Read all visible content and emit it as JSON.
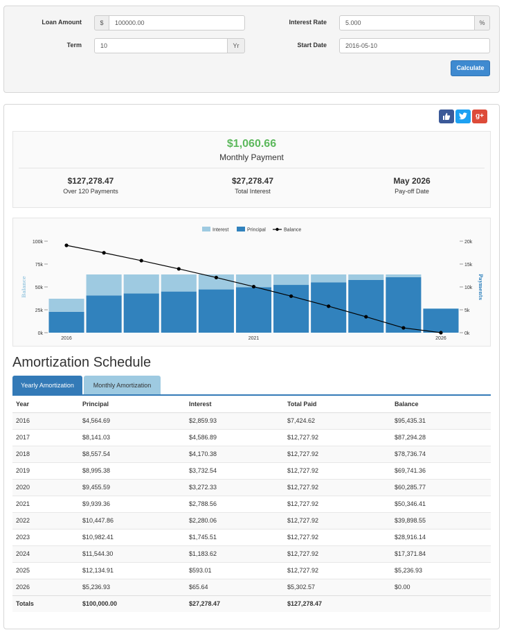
{
  "form": {
    "loan_amount_label": "Loan Amount",
    "currency_addon": "$",
    "loan_amount_value": "100000.00",
    "interest_rate_label": "Interest Rate",
    "interest_rate_value": "5.000",
    "percent_addon": "%",
    "term_label": "Term",
    "term_value": "10",
    "term_addon": "Yr",
    "start_date_label": "Start Date",
    "start_date_value": "2016-05-10",
    "calculate_label": "Calculate"
  },
  "share": {
    "like_icon": "thumbs-up-icon",
    "twitter_icon": "twitter-icon",
    "gplus_label": "g+",
    "colors": {
      "like": "#3b5998",
      "twitter": "#1da1f2",
      "gplus": "#dd4b39"
    }
  },
  "summary": {
    "monthly_payment": "$1,060.66",
    "monthly_payment_label": "Monthly Payment",
    "total_paid": "$127,278.47",
    "total_paid_label": "Over 120 Payments",
    "total_interest": "$27,278.47",
    "total_interest_label": "Total Interest",
    "payoff_date": "May 2026",
    "payoff_label": "Pay-off Date",
    "accent_color": "#5cb85c"
  },
  "chart_data": {
    "type": "bar",
    "legend": [
      "Interest",
      "Principal",
      "Balance"
    ],
    "legend_position": "top-center",
    "ylabel_left": "Balance",
    "ylabel_right": "Payments",
    "left_ticks": [
      "0k",
      "25k",
      "50k",
      "75k",
      "100k"
    ],
    "right_ticks": [
      "0k",
      "5k",
      "10k",
      "15k",
      "20k"
    ],
    "x_ticks": [
      "2016",
      "2021",
      "2026"
    ],
    "left_ylim": [
      0,
      100000
    ],
    "right_ylim": [
      0,
      20000
    ],
    "categories": [
      "2016",
      "2017",
      "2018",
      "2019",
      "2020",
      "2021",
      "2022",
      "2023",
      "2024",
      "2025",
      "2026"
    ],
    "series": [
      {
        "name": "Principal",
        "axis": "right",
        "values": [
          4564.69,
          8141.03,
          8557.54,
          8995.38,
          9455.59,
          9939.36,
          10447.86,
          10982.41,
          11544.3,
          12134.91,
          5236.93
        ]
      },
      {
        "name": "Interest",
        "axis": "right",
        "values": [
          2859.93,
          4586.89,
          4170.38,
          3732.54,
          3272.33,
          2788.56,
          2280.06,
          1745.51,
          1183.62,
          593.01,
          65.64
        ]
      },
      {
        "name": "Balance",
        "axis": "left",
        "values": [
          95435.31,
          87294.28,
          78736.74,
          69741.36,
          60285.77,
          50346.41,
          39898.55,
          28916.14,
          17371.84,
          5236.93,
          0.0
        ]
      }
    ],
    "colors": {
      "Interest": "#9ecae1",
      "Principal": "#3182bd",
      "Balance": "#000000"
    },
    "grid": false
  },
  "schedule": {
    "title": "Amortization Schedule",
    "tabs": [
      "Yearly Amortization",
      "Monthly Amortization"
    ],
    "headers": [
      "Year",
      "Principal",
      "Interest",
      "Total Paid",
      "Balance"
    ],
    "rows": [
      [
        "2016",
        "$4,564.69",
        "$2,859.93",
        "$7,424.62",
        "$95,435.31"
      ],
      [
        "2017",
        "$8,141.03",
        "$4,586.89",
        "$12,727.92",
        "$87,294.28"
      ],
      [
        "2018",
        "$8,557.54",
        "$4,170.38",
        "$12,727.92",
        "$78,736.74"
      ],
      [
        "2019",
        "$8,995.38",
        "$3,732.54",
        "$12,727.92",
        "$69,741.36"
      ],
      [
        "2020",
        "$9,455.59",
        "$3,272.33",
        "$12,727.92",
        "$60,285.77"
      ],
      [
        "2021",
        "$9,939.36",
        "$2,788.56",
        "$12,727.92",
        "$50,346.41"
      ],
      [
        "2022",
        "$10,447.86",
        "$2,280.06",
        "$12,727.92",
        "$39,898.55"
      ],
      [
        "2023",
        "$10,982.41",
        "$1,745.51",
        "$12,727.92",
        "$28,916.14"
      ],
      [
        "2024",
        "$11,544.30",
        "$1,183.62",
        "$12,727.92",
        "$17,371.84"
      ],
      [
        "2025",
        "$12,134.91",
        "$593.01",
        "$12,727.92",
        "$5,236.93"
      ],
      [
        "2026",
        "$5,236.93",
        "$65.64",
        "$5,302.57",
        "$0.00"
      ]
    ],
    "totals": [
      "Totals",
      "$100,000.00",
      "$27,278.47",
      "$127,278.47",
      ""
    ]
  }
}
